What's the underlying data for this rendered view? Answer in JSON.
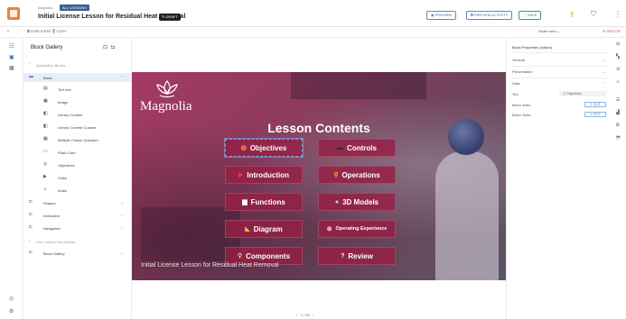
{
  "header": {
    "breadcrumb": "Magnolia",
    "breadcrumb_tag": "ALL LESSONS",
    "title": "Initial License Lesson for Residual Heat Removal",
    "draft_label": "DRAFT",
    "preview_label": "PREVIEW",
    "preview_activity_label": "PREVIEW ACTIVITY",
    "save_label": "SAVE"
  },
  "toolbar": {
    "duplicate_label": "DUPLICATE",
    "copy_label": "COPY",
    "slider_label": "Slider view",
    "delete_label": "DELETE"
  },
  "gallery": {
    "title": "Block Gallery",
    "application_blocks_label": "Application Blocks",
    "basic_label": "Basic",
    "basic_items": [
      {
        "label": "Text box",
        "icon": "text-icon"
      },
      {
        "label": "Image",
        "icon": "image-icon"
      },
      {
        "label": "Library Content",
        "icon": "library-icon"
      },
      {
        "label": "Library Content Custom",
        "icon": "library-icon"
      },
      {
        "label": "Multiple Choice Question",
        "icon": "question-icon"
      },
      {
        "label": "Flash Card",
        "icon": "card-icon"
      },
      {
        "label": "Objectives",
        "icon": "target-icon"
      },
      {
        "label": "Video",
        "icon": "video-icon"
      },
      {
        "label": "Audio",
        "icon": "audio-icon"
      }
    ],
    "groups": [
      {
        "label": "Shapes"
      },
      {
        "label": "Interactive"
      },
      {
        "label": "Navigation"
      }
    ],
    "flex_blocks_label": "Flex Lesson Flex Blocks",
    "block_gallery_label": "Block Gallery"
  },
  "slide": {
    "brand": "Magnolia",
    "heading": "Lesson Contents",
    "footer": "Initial License Lesson for Residual Heat Removal",
    "buttons": [
      {
        "label": "Objectives",
        "glyph": "◎",
        "glyph_color": "#ffcc33"
      },
      {
        "label": "Controls",
        "glyph": "▬",
        "glyph_color": "#2b2b2b"
      },
      {
        "label": "Introduction",
        "glyph": "▶",
        "glyph_color": "#e03a3a"
      },
      {
        "label": "Operations",
        "glyph": "⚲",
        "glyph_color": "#f2c230"
      },
      {
        "label": "Functions",
        "glyph": "▆",
        "glyph_color": "#ffffff"
      },
      {
        "label": "3D Models",
        "glyph": "●",
        "glyph_color": "#bcd7f5"
      },
      {
        "label": "Diagram",
        "glyph": "◣",
        "glyph_color": "#f2b731"
      },
      {
        "label": "Operating Experience",
        "glyph": "⊕",
        "glyph_color": "#f2d2dc"
      },
      {
        "label": "Components",
        "glyph": "⚲",
        "glyph_color": "#f6d44a"
      },
      {
        "label": "Review",
        "glyph": "?",
        "glyph_color": "#ffffff"
      }
    ]
  },
  "pager": {
    "prev": "‹",
    "current": "1",
    "total": "26",
    "next": "›"
  },
  "properties": {
    "title": "Block Properties (button)",
    "sections": [
      "General",
      "Presentation",
      "Data"
    ],
    "text_label": "Text",
    "text_value": "Objectives",
    "button_action_label": "Button action",
    "button_styles_label": "Button Styles",
    "edit_label": "EDIT"
  },
  "colors": {
    "accent": "#3b6fb6",
    "delete": "#d63b3b",
    "slide_button": "#961e46"
  }
}
